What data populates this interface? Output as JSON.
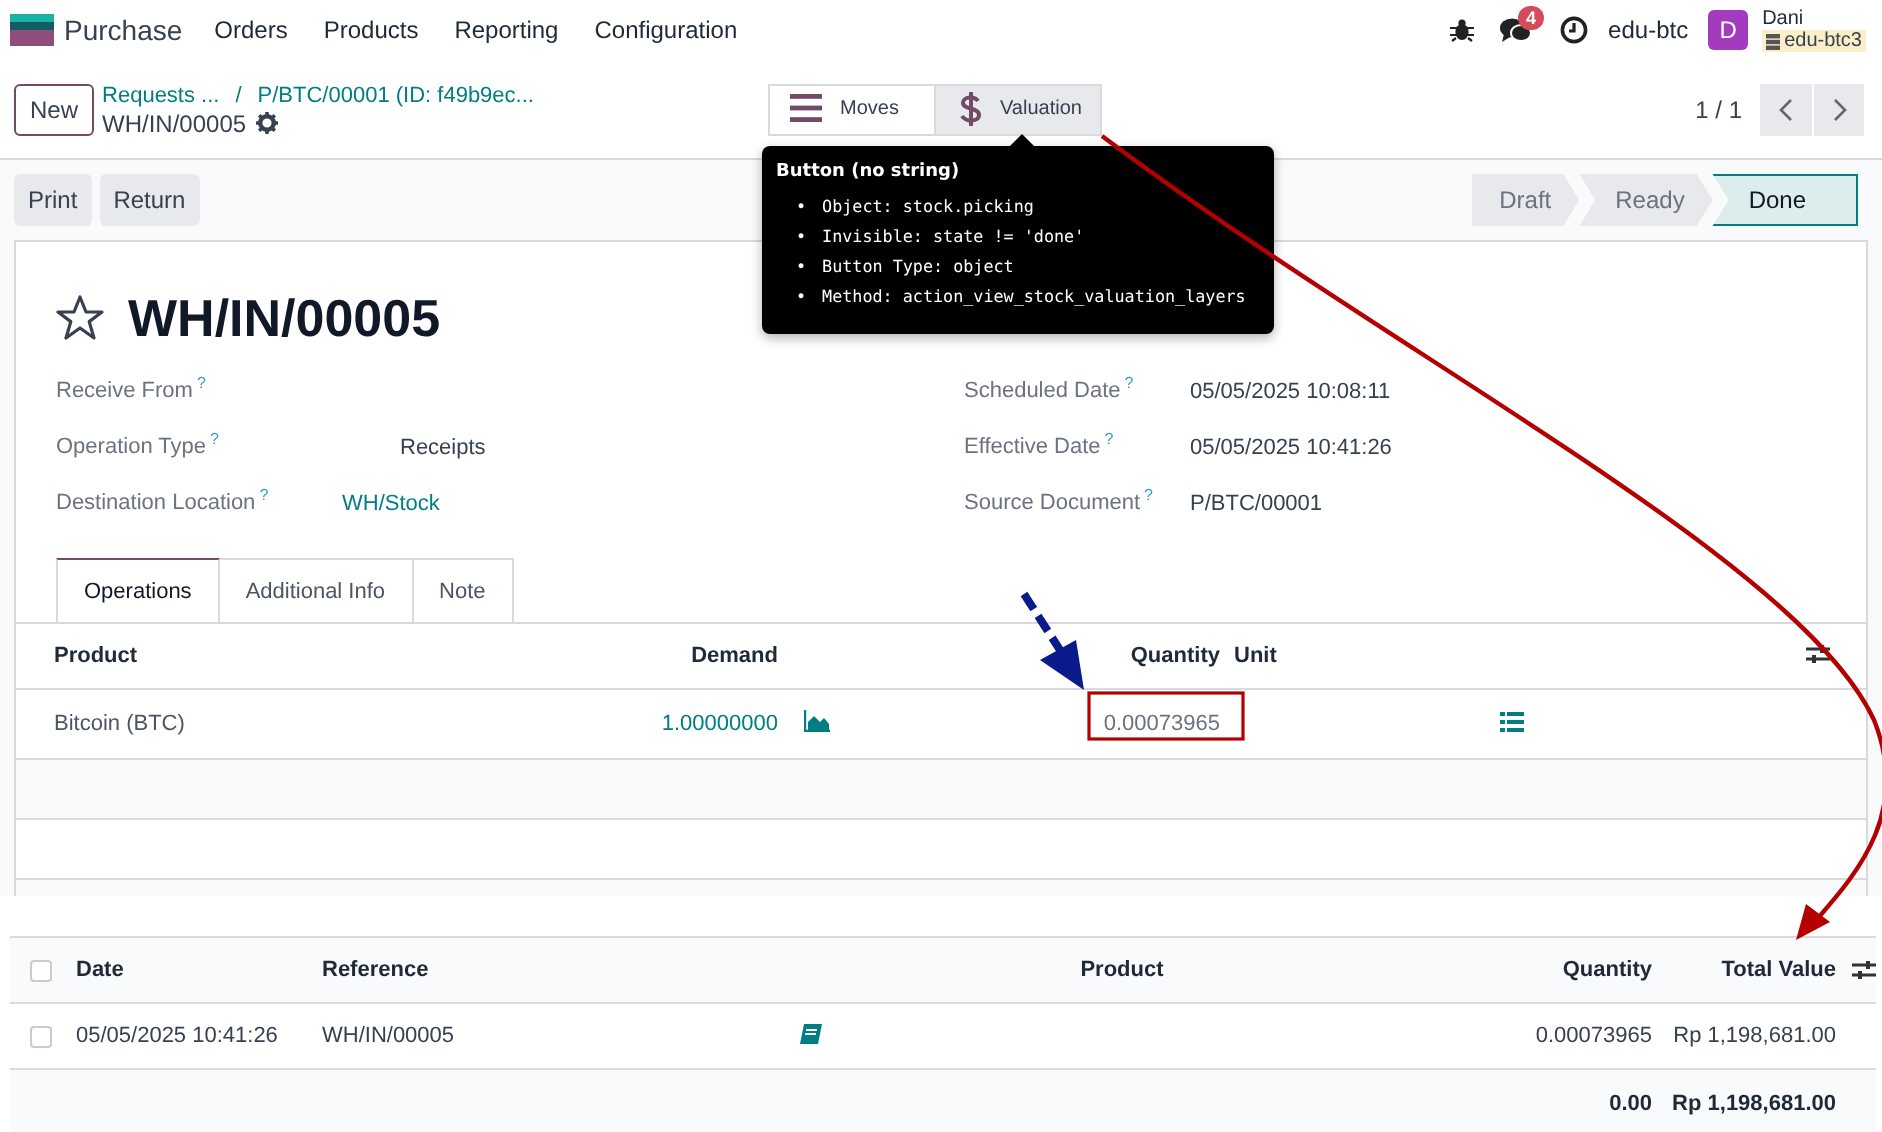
{
  "navbar": {
    "app": "Purchase",
    "menu": [
      "Orders",
      "Products",
      "Reporting",
      "Configuration"
    ],
    "message_count": "4",
    "company": "edu-btc",
    "user": {
      "initial": "D",
      "name": "Dani",
      "database": "edu-btc3"
    }
  },
  "control_panel": {
    "new_button": "New",
    "breadcrumbs": [
      "Requests ...",
      "P/BTC/00001 (ID: f49b9ec..."
    ],
    "breadcrumb_separator": "/",
    "record": "WH/IN/00005",
    "smart_buttons": [
      {
        "label": "Moves",
        "kind": "moves",
        "selected": false
      },
      {
        "label": "Valuation",
        "kind": "valuation",
        "selected": true
      }
    ],
    "pager": "1 / 1"
  },
  "tooltip": {
    "title": "Button (no string)",
    "items": [
      {
        "bullet": "•",
        "key": "Object:",
        "value": "stock.picking"
      },
      {
        "bullet": "•",
        "key": "Invisible:",
        "value": "state != 'done'"
      },
      {
        "bullet": "•",
        "key": "Button Type:",
        "value": "object"
      },
      {
        "bullet": "•",
        "key": "Method:",
        "value": "action_view_stock_valuation_layers"
      }
    ]
  },
  "actions": [
    "Print",
    "Return"
  ],
  "status_bar": [
    {
      "label": "Draft",
      "selected": false
    },
    {
      "label": "Ready",
      "selected": false
    },
    {
      "label": "Done",
      "selected": true
    }
  ],
  "form": {
    "starred": false,
    "title": "WH/IN/00005",
    "left_fields": [
      {
        "label": "Receive From",
        "help": "?"
      },
      {
        "label": "Operation Type",
        "help": "?",
        "kind": "text",
        "value": "Receipts"
      },
      {
        "label": "Destination Location",
        "help": "?",
        "kind": "link",
        "value": "WH/Stock"
      }
    ],
    "right_fields": [
      {
        "label": "Scheduled Date",
        "help": "?",
        "kind": "text",
        "value": "05/05/2025 10:08:11"
      },
      {
        "label": "Effective Date",
        "help": "?",
        "kind": "text",
        "value": "05/05/2025 10:41:26"
      },
      {
        "label": "Source Document",
        "help": "?",
        "kind": "text",
        "value": "P/BTC/00001"
      }
    ],
    "tabs": [
      {
        "label": "Operations",
        "selected": true
      },
      {
        "label": "Additional Info",
        "selected": false
      },
      {
        "label": "Note",
        "selected": false
      }
    ],
    "operations": {
      "columns": [
        "Product",
        "Demand",
        "Quantity",
        "Unit"
      ],
      "rows": [
        {
          "product": "Bitcoin (BTC)",
          "demand": "1.00000000",
          "quantity": "0.00073965"
        }
      ]
    }
  },
  "valuation": {
    "select_all": false,
    "columns": [
      "Date",
      "Reference",
      "Product",
      "Quantity",
      "Total Value"
    ],
    "rows": [
      {
        "selected": false,
        "date": "05/05/2025 10:41:26",
        "reference": "WH/IN/00005",
        "quantity": "0.00073965",
        "total_value": "Rp 1,198,681.00"
      }
    ],
    "totals": {
      "quantity": "0.00",
      "total_value": "Rp 1,198,681.00"
    }
  }
}
